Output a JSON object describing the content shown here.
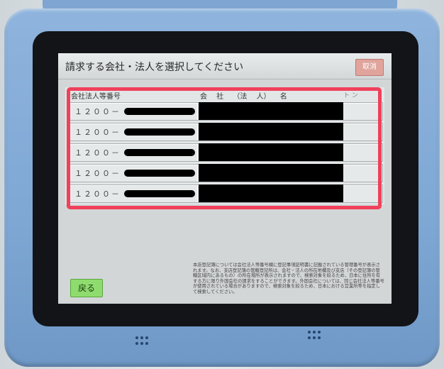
{
  "screen": {
    "title": "請求する会社・法人を選択してください",
    "close_button": {
      "label": "取消"
    }
  },
  "table": {
    "headers": {
      "number": "会社法人等番号",
      "name": "会 社 （法 人） 名",
      "extra": "ト ン"
    },
    "rows": [
      {
        "number": "１２００－"
      },
      {
        "number": "１２００－"
      },
      {
        "number": "１２００－"
      },
      {
        "number": "１２００－"
      },
      {
        "number": "１２００－"
      }
    ]
  },
  "footer": {
    "back_button": {
      "label": "戻る"
    },
    "notice": "本店登記簿については会社法人等番号欄に登記事項証明書に記載されている管理番号が表示されます。なお、支店登記簿の管轄登記所は、会社・法人の所在地欄及び支店（その登記簿の管轄区域内にあるもの）の所在場所が表示されますので、検索対象を絞るため、日本に住所を有する方に限り外国会社の請求をすることができます。外国会社については、同じ会社法人等番号が使用されている場合がありますので、検索対象を絞るため、日本における営業所等を指定して検索してください。"
  },
  "colors": {
    "highlight": "#f0405a",
    "back_button": "#8fdc6e",
    "close_button": "#e0a49c",
    "bezel": "#7ea7d4"
  }
}
